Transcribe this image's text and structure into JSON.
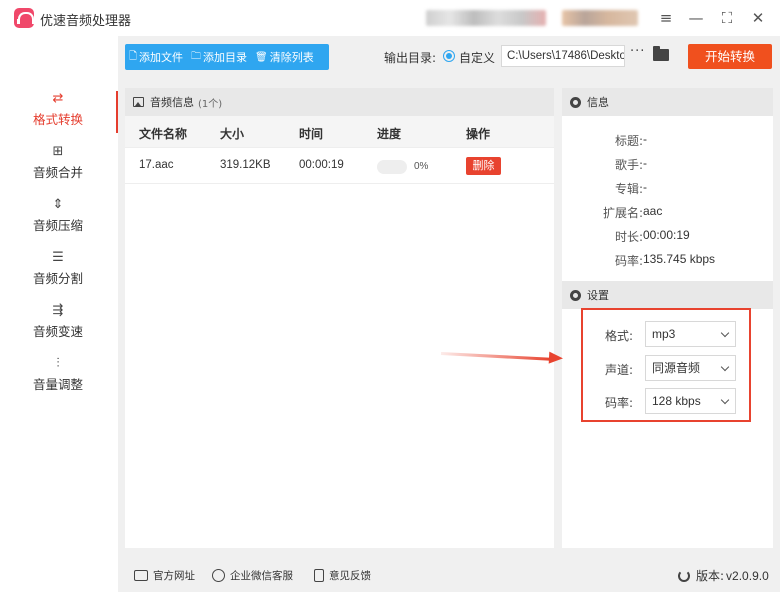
{
  "app": {
    "title": "优速音频处理器"
  },
  "window_controls": {
    "menu": "≡",
    "minimize": "—",
    "maximize": "⛶",
    "close": "✕"
  },
  "sidebar": {
    "items": [
      {
        "label": "格式转换",
        "icon": "convert-icon",
        "glyph": "⇄",
        "active": true
      },
      {
        "label": "音频合并",
        "icon": "merge-icon",
        "glyph": "⊞",
        "active": false
      },
      {
        "label": "音频压缩",
        "icon": "compress-icon",
        "glyph": "⇕",
        "active": false
      },
      {
        "label": "音频分割",
        "icon": "split-icon",
        "glyph": "☰",
        "active": false
      },
      {
        "label": "音频变速",
        "icon": "speed-icon",
        "glyph": "⇶",
        "active": false
      },
      {
        "label": "音量调整",
        "icon": "volume-icon",
        "glyph": "⫶",
        "active": false
      }
    ]
  },
  "toolbar": {
    "add_file": "添加文件",
    "add_folder": "添加目录",
    "clear_list": "清除列表",
    "output_label": "输出目录:",
    "custom_label": "自定义",
    "output_path": "C:\\Users\\17486\\Deskto",
    "more": "···",
    "start": "开始转换"
  },
  "file_panel": {
    "title": "音频信息",
    "count": "(1个)",
    "columns": {
      "name": "文件名称",
      "size": "大小",
      "time": "时间",
      "progress": "进度",
      "action": "操作"
    },
    "rows": [
      {
        "name": "17.aac",
        "size": "319.12KB",
        "time": "00:00:19",
        "progress_fraction": 0,
        "progress_text": "0%",
        "action": "删除"
      }
    ]
  },
  "info": {
    "title": "信息",
    "fields": [
      {
        "key": "标题:",
        "value": "-"
      },
      {
        "key": "歌手:",
        "value": "-"
      },
      {
        "key": "专辑:",
        "value": "-"
      },
      {
        "key": "扩展名:",
        "value": "aac"
      },
      {
        "key": "时长:",
        "value": "00:00:19"
      },
      {
        "key": "码率:",
        "value": "135.745 kbps"
      }
    ]
  },
  "settings": {
    "title": "设置",
    "format": {
      "label": "格式:",
      "value": "mp3"
    },
    "channel": {
      "label": "声道:",
      "value": "同源音频"
    },
    "bitrate": {
      "label": "码率:",
      "value": "128 kbps"
    }
  },
  "footer": {
    "website": "官方网址",
    "wechat": "企业微信客服",
    "feedback": "意见反馈",
    "version_label": "版本:",
    "version": "v2.0.9.0"
  },
  "colors": {
    "accent_blue": "#2fa6f0",
    "accent_red": "#e8432f",
    "start_orange": "#f0501e"
  }
}
